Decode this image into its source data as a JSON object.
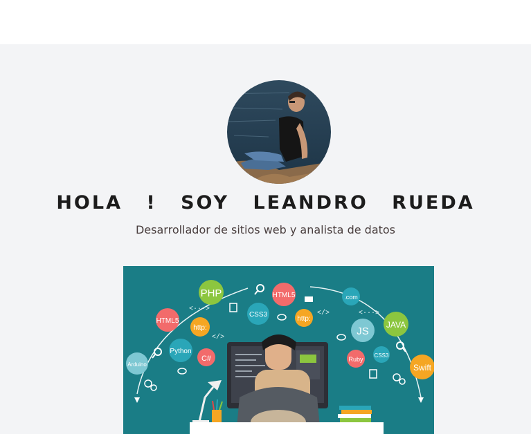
{
  "hero": {
    "title": "HOLA ! SOY LEANDRO RUEDA",
    "subtitle": "Desarrollador de sitios web y analista de datos"
  },
  "banner": {
    "bubbles": [
      {
        "label": "PHP",
        "color": "#8cc63f"
      },
      {
        "label": "HTML5",
        "color": "#f26b6b"
      },
      {
        "label": ".com",
        "color": "#2aa6b8"
      },
      {
        "label": "HTML5",
        "color": "#f26b6b"
      },
      {
        "label": "CSS3",
        "color": "#2aa6b8"
      },
      {
        "label": "http:",
        "color": "#f5a623"
      },
      {
        "label": "http:",
        "color": "#f5a623"
      },
      {
        "label": "JS",
        "color": "#7ec8d3"
      },
      {
        "label": "JAVA",
        "color": "#8cc63f"
      },
      {
        "label": "Python",
        "color": "#2aa6b8"
      },
      {
        "label": "C#",
        "color": "#f26b6b"
      },
      {
        "label": "Arduino",
        "color": "#7ec8d3"
      },
      {
        "label": "Ruby",
        "color": "#f26b6b"
      },
      {
        "label": "CSS3",
        "color": "#2aa6b8"
      },
      {
        "label": "Swift",
        "color": "#f5a623"
      }
    ],
    "symbols": [
      "<···>",
      "</>",
      "</>",
      "<···>"
    ]
  },
  "colors": {
    "hero_background": "#f3f4f6",
    "banner_background": "#1a7d86",
    "title_color": "#1c1c1c"
  }
}
